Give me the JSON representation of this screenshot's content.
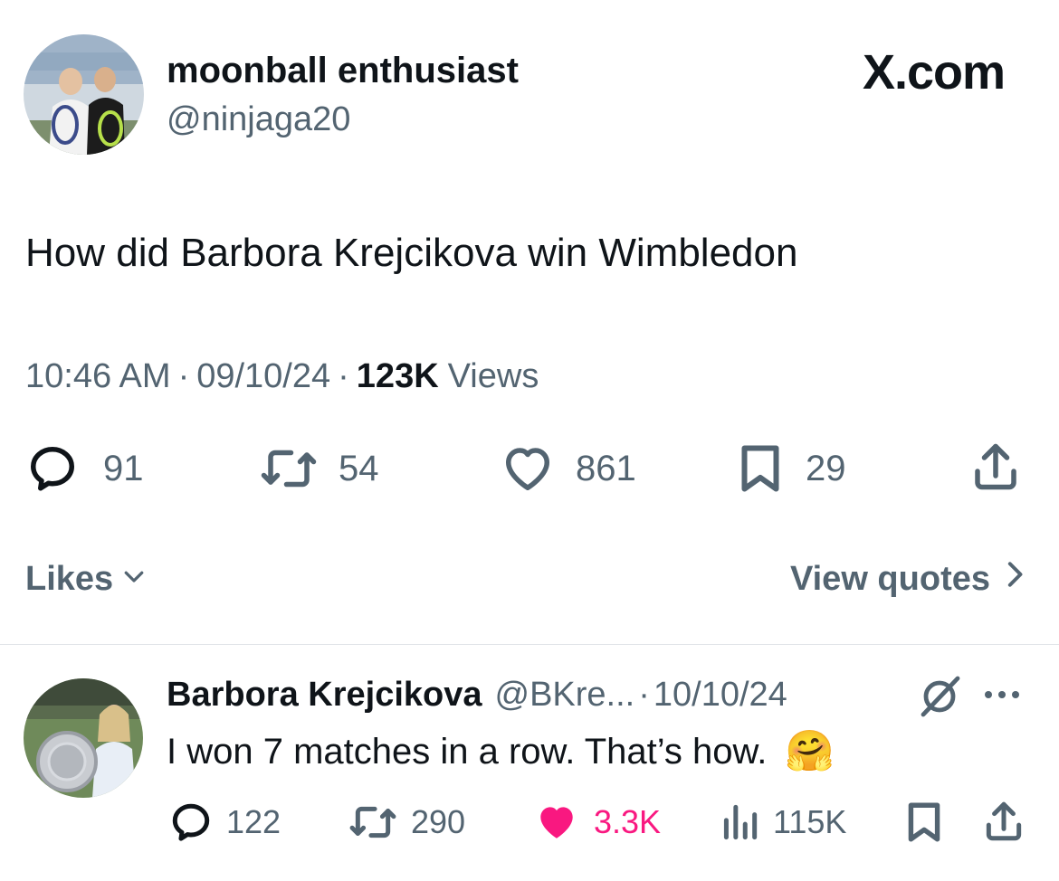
{
  "post": {
    "display_name": "moonball enthusiast",
    "handle": "@ninjaga20",
    "brand": "X.com",
    "text": "How did Barbora Krejcikova win Wimbledon",
    "time": "10:46 AM",
    "sep1": "·",
    "date": "09/10/24",
    "sep2": "·",
    "views_count": "123K",
    "views_label": "Views",
    "replies": "91",
    "reposts": "54",
    "likes": "861",
    "bookmarks": "29",
    "icons": [
      "reply-icon",
      "repost-icon",
      "heart-icon",
      "bookmark-icon",
      "share-icon"
    ]
  },
  "footer": {
    "likes_label": "Likes",
    "view_quotes_label": "View quotes",
    "icons": [
      "chevron-down-icon",
      "chevron-right-icon"
    ]
  },
  "reply": {
    "display_name": "Barbora Krejcikova",
    "handle": "@BKre...",
    "sep": "·",
    "date": "10/10/24",
    "text": "I won 7 matches in a row. That’s how.",
    "emoji": "🤗",
    "replies": "122",
    "reposts": "290",
    "likes": "3.3K",
    "views": "115K",
    "icons": [
      "grok-icon",
      "more-icon",
      "reply-icon",
      "repost-icon",
      "heart-filled-icon",
      "views-icon",
      "bookmark-icon",
      "share-icon"
    ]
  },
  "colors": {
    "text": "#0f1419",
    "secondary": "#536471",
    "like_active": "#f91880",
    "divider": "#e1e4e8"
  }
}
